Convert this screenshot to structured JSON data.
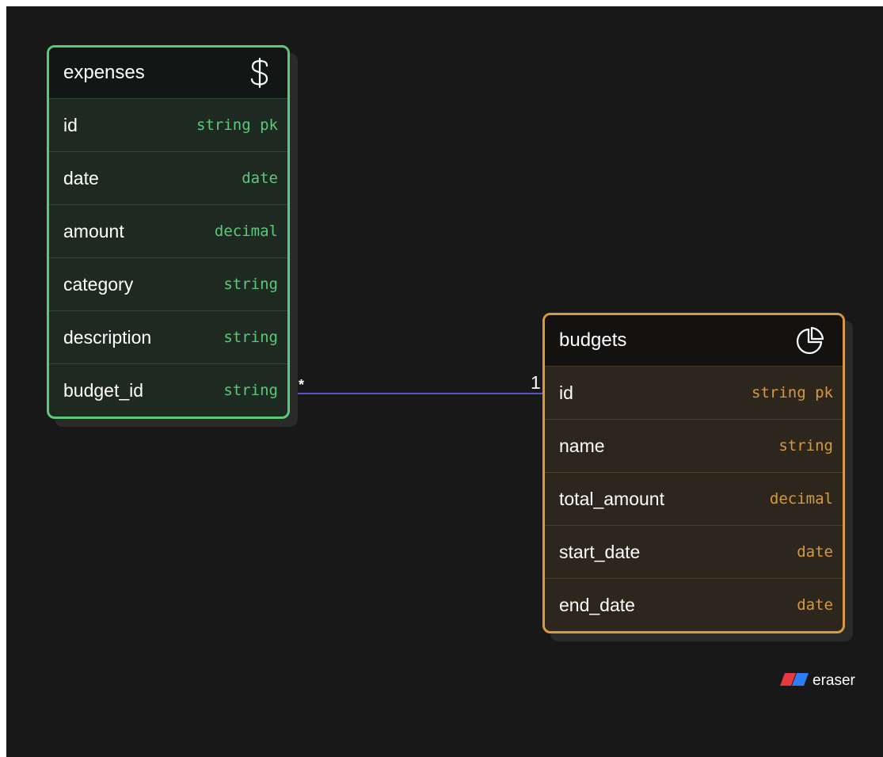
{
  "diagram": {
    "entities": [
      {
        "id": "expenses",
        "name": "expenses",
        "icon": "dollar-sign-icon",
        "color": "#5dc879",
        "fields": [
          {
            "name": "id",
            "type": "string pk"
          },
          {
            "name": "date",
            "type": "date"
          },
          {
            "name": "amount",
            "type": "decimal"
          },
          {
            "name": "category",
            "type": "string"
          },
          {
            "name": "description",
            "type": "string"
          },
          {
            "name": "budget_id",
            "type": "string"
          }
        ]
      },
      {
        "id": "budgets",
        "name": "budgets",
        "icon": "pie-chart-icon",
        "color": "#d99a3f",
        "fields": [
          {
            "name": "id",
            "type": "string pk"
          },
          {
            "name": "name",
            "type": "string"
          },
          {
            "name": "total_amount",
            "type": "decimal"
          },
          {
            "name": "start_date",
            "type": "date"
          },
          {
            "name": "end_date",
            "type": "date"
          }
        ]
      }
    ],
    "relationship": {
      "from": "expenses.budget_id",
      "to": "budgets.id",
      "from_cardinality": "*",
      "to_cardinality": "1",
      "color": "#5b54c4"
    }
  },
  "brand": {
    "name": "eraser",
    "icon": "eraser-logo-icon",
    "colors": [
      "#e8393f",
      "#2e7cf6"
    ]
  },
  "colors": {
    "background": "#181818"
  }
}
